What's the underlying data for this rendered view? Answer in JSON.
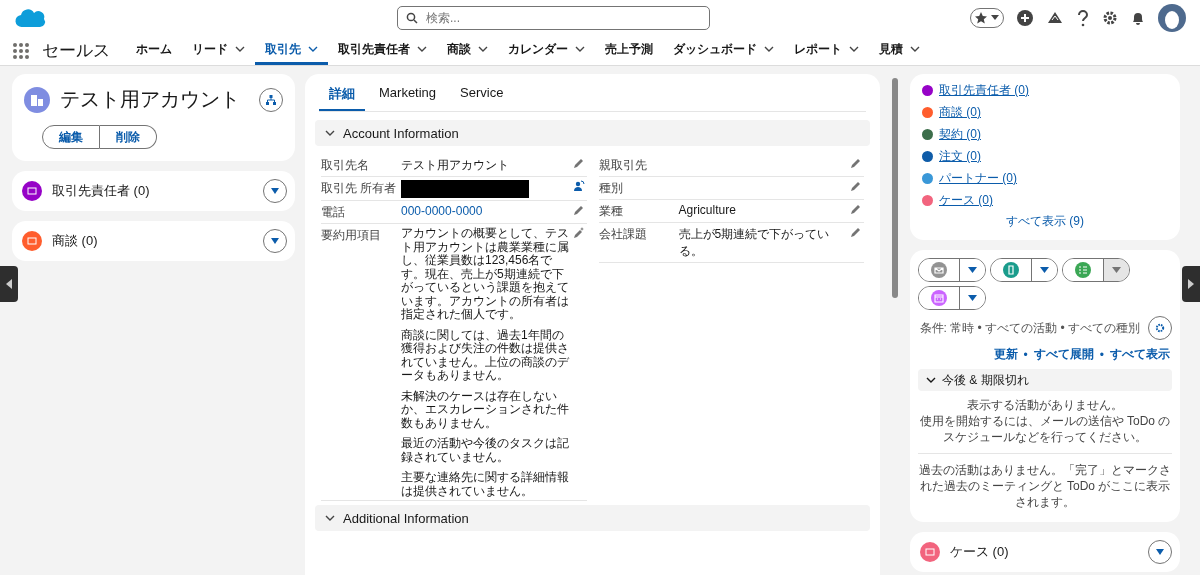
{
  "header": {
    "search": {
      "placeholder": "検索..."
    }
  },
  "app_name": "セールス",
  "nav": [
    {
      "label": "ホーム",
      "has_menu": false,
      "selected": false
    },
    {
      "label": "リード",
      "has_menu": true,
      "selected": false
    },
    {
      "label": "取引先",
      "has_menu": true,
      "selected": true
    },
    {
      "label": "取引先責任者",
      "has_menu": true,
      "selected": false
    },
    {
      "label": "商談",
      "has_menu": true,
      "selected": false
    },
    {
      "label": "カレンダー",
      "has_menu": true,
      "selected": false
    },
    {
      "label": "売上予測",
      "has_menu": false,
      "selected": false
    },
    {
      "label": "ダッシュボード",
      "has_menu": true,
      "selected": false
    },
    {
      "label": "レポート",
      "has_menu": true,
      "selected": false
    },
    {
      "label": "見積",
      "has_menu": true,
      "selected": false
    }
  ],
  "record": {
    "title": "テスト用アカウント",
    "actions": [
      "編集",
      "削除"
    ]
  },
  "left_related": [
    {
      "label": "取引先責任者 (0)",
      "color": "#9602c7"
    },
    {
      "label": "商談 (0)",
      "color": "#ff5d2d"
    }
  ],
  "detail_tabs": [
    {
      "label": "詳細",
      "selected": true
    },
    {
      "label": "Marketing",
      "selected": false
    },
    {
      "label": "Service",
      "selected": false
    }
  ],
  "section": {
    "title": "Account Information",
    "expanded": true
  },
  "fields_left": [
    {
      "label": "取引先名",
      "kind": "text",
      "value": "テスト用アカウント"
    },
    {
      "label": "取引先 所有者",
      "kind": "redacted"
    },
    {
      "label": "電話",
      "kind": "link",
      "value": "000-0000-0000"
    },
    {
      "label": "要約用項目",
      "kind": "paragraphs",
      "paragraphs": [
        "アカウントの概要として、テスト用アカウントは農業業種に属し、従業員数は123,456名です。現在、売上が5期連続で下がっているという課題を抱えています。アカウントの所有者は指定された個人です。",
        "商談に関しては、過去1年間の獲得および失注の件数は提供されていません。上位の商談のデータもありません。",
        "未解決のケースは存在しないか、エスカレーションされた件数もありません。",
        "最近の活動や今後のタスクは記録されていません。",
        "主要な連絡先に関する詳細情報は提供されていません。"
      ]
    }
  ],
  "fields_right": [
    {
      "label": "親取引先",
      "kind": "text"
    },
    {
      "label": "種別",
      "kind": "text"
    },
    {
      "label": "業種",
      "kind": "text",
      "value": "Agriculture"
    },
    {
      "label": "会社課題",
      "kind": "text",
      "value": "売上が5期連続で下がっている。"
    }
  ],
  "section2": {
    "title": "Additional Information",
    "expanded": true
  },
  "quick_links": [
    {
      "label": "取引先責任者 (0)",
      "color": "#9602c7"
    },
    {
      "label": "商談 (0)",
      "color": "#ff5d2d"
    },
    {
      "label": "契約 (0)",
      "color": "#3c6e4b"
    },
    {
      "label": "注文 (0)",
      "color": "#0f5ca8"
    },
    {
      "label": "パートナー (0)",
      "color": "#3a98d8"
    },
    {
      "label": "ケース (0)",
      "color": "#f2647e"
    }
  ],
  "quick_links_all": "すべて表示 (9)",
  "activity": {
    "buttons": [
      {
        "kind": "mail",
        "color": "#939393",
        "menu_disabled": false
      },
      {
        "kind": "call",
        "color": "#1a9c8c",
        "menu_disabled": false
      },
      {
        "kind": "task",
        "color": "#3ba755",
        "menu_disabled": true
      },
      {
        "kind": "event",
        "color": "#cb65ff",
        "menu_disabled": false
      }
    ],
    "filter": "条件: 常時 • すべての活動 • すべての種別",
    "links": [
      "更新",
      "すべて展開",
      "すべて表示"
    ],
    "link_separator": "•",
    "group": {
      "title": "今後 & 期限切れ",
      "expanded": true
    },
    "empty_lines": [
      "表示する活動がありません。",
      "使用を開始するには、メールの送信や ToDo のスケジュールなどを行ってください。"
    ],
    "past": "過去の活動はありません。「完了」とマークされた過去のミーティングと ToDo がここに表示されます。"
  },
  "right_related": [
    {
      "label": "ケース (0)",
      "color": "#f2647e"
    }
  ]
}
